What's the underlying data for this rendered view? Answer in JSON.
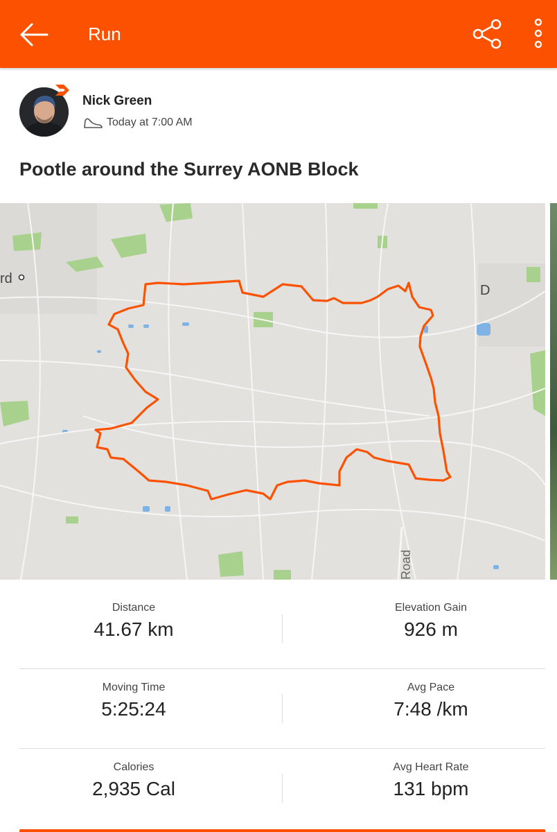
{
  "appbar": {
    "title": "Run"
  },
  "athlete": {
    "name": "Nick Green",
    "time": "Today at 7:00 AM"
  },
  "activity": {
    "title": "Pootle around the Surrey AONB Block"
  },
  "map": {
    "labels": {
      "left_place": "rd",
      "right_place": "D",
      "road": "Road"
    }
  },
  "stats": [
    {
      "left": {
        "label": "Distance",
        "value": "41.67 km"
      },
      "right": {
        "label": "Elevation Gain",
        "value": "926 m"
      }
    },
    {
      "left": {
        "label": "Moving Time",
        "value": "5:25:24"
      },
      "right": {
        "label": "Avg Pace",
        "value": "7:48 /km"
      }
    },
    {
      "left": {
        "label": "Calories",
        "value": "2,935 Cal"
      },
      "right": {
        "label": "Avg Heart Rate",
        "value": "131 bpm"
      }
    }
  ],
  "colors": {
    "brand": "#fc5200",
    "route": "#fc5200",
    "map_bg": "#e3e1dd",
    "park": "#a9d18e",
    "water": "#7fb3e6"
  },
  "icons": [
    "back-arrow-icon",
    "share-icon",
    "more-vert-icon",
    "shoe-icon",
    "strava-badge-icon"
  ]
}
